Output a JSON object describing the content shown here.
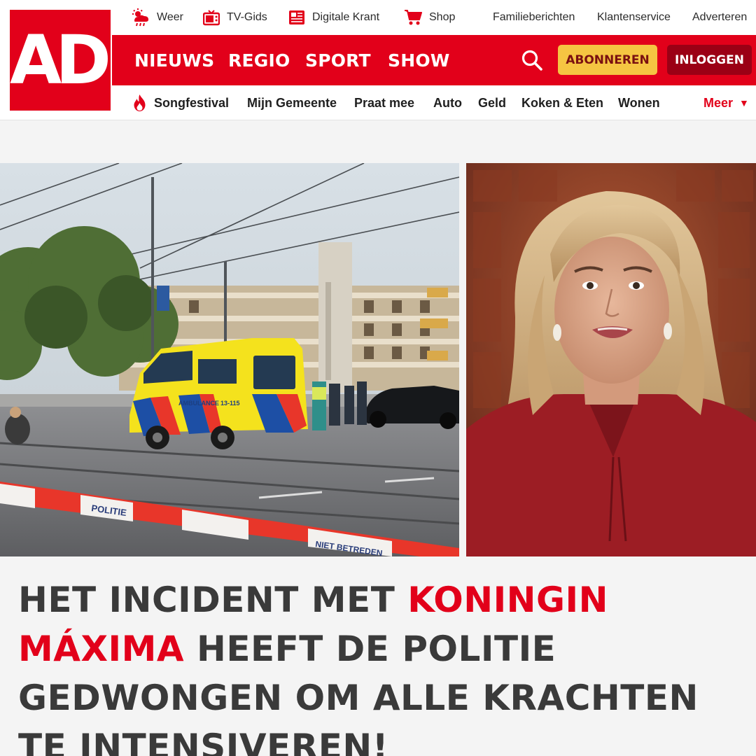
{
  "brand": {
    "logo_text": "AD",
    "color": "#e2001a"
  },
  "topbar": {
    "weather": "Weer",
    "tv_guide": "TV-Gids",
    "digital_paper": "Digitale Krant",
    "shop": "Shop",
    "family_notices": "Familieberichten",
    "customer_service": "Klantenservice",
    "advertise": "Adverteren"
  },
  "mainnav": {
    "items": [
      "NIEUWS",
      "REGIO",
      "SPORT",
      "SHOW"
    ],
    "subscribe": "ABONNEREN",
    "login": "INLOGGEN",
    "subscribe_color": "#f5c542",
    "login_color": "#9b0015"
  },
  "subnav": {
    "items": [
      "Songfestival",
      "Mijn Gemeente",
      "Praat mee",
      "Auto",
      "Geld",
      "Koken & Eten",
      "Wonen"
    ],
    "more": "Meer"
  },
  "images": {
    "left_van_text": "AMBULANCE",
    "left_van_number": "13-115",
    "left_tape_text": "POLITIE",
    "left_tape_text_2": "NIET BETREDEN"
  },
  "headline": {
    "part1": "HET INCIDENT MET ",
    "highlight": "KONINGIN MÁXIMA",
    "part2": " HEEFT DE POLITIE GEDWONGEN OM ALLE KRACHTEN TE INTENSIVEREN!"
  }
}
